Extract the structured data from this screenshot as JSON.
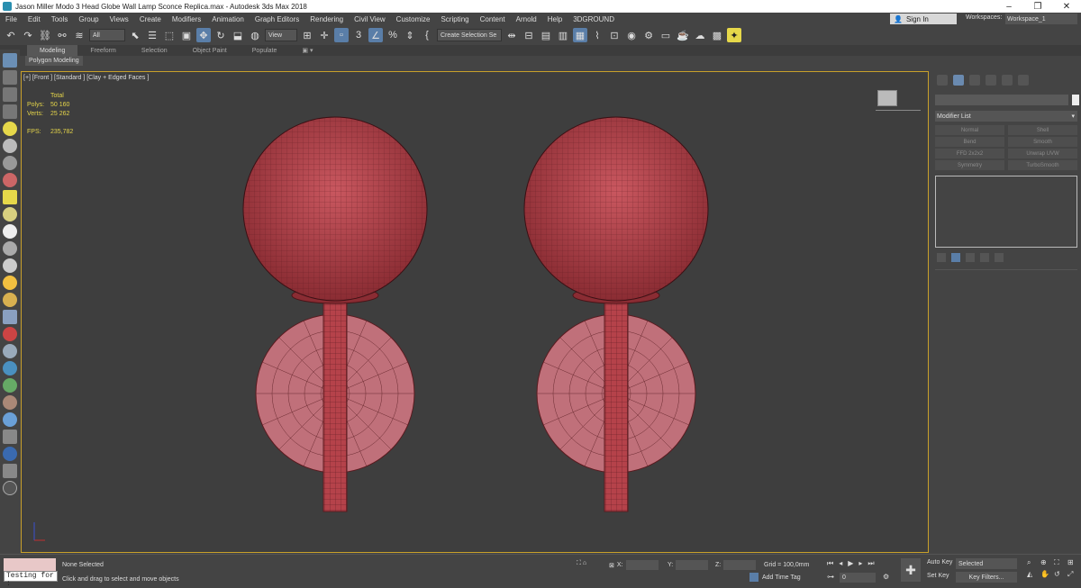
{
  "titlebar": {
    "title": "Jason Miller Modo 3 Head Globe Wall Lamp Sconce Replica.max - Autodesk 3ds Max 2018",
    "minimize": "–",
    "maximize": "❐",
    "close": "✕"
  },
  "menu": {
    "items": [
      "File",
      "Edit",
      "Tools",
      "Group",
      "Views",
      "Create",
      "Modifiers",
      "Animation",
      "Graph Editors",
      "Rendering",
      "Civil View",
      "Customize",
      "Scripting",
      "Content",
      "Arnold",
      "Help",
      "3DGROUND"
    ],
    "sign_in": "Sign In",
    "workspaces_label": "Workspaces:",
    "workspace_value": "Workspace_1"
  },
  "toolbar": {
    "filter_value": "All",
    "refcoord_value": "View",
    "snap_label": "3",
    "named_selection_placeholder": "Create Selection Se"
  },
  "ribbon": {
    "tabs": [
      "Modeling",
      "Freeform",
      "Selection",
      "Object Paint",
      "Populate"
    ],
    "sub_label": "Polygon Modeling"
  },
  "viewport": {
    "label": "[+] [Front ] [Standard ] [Clay + Edged Faces ]",
    "stats": {
      "total_label": "Total",
      "polys_label": "Polys:",
      "polys_value": "50 160",
      "verts_label": "Verts:",
      "verts_value": "25 262",
      "fps_label": "FPS:",
      "fps_value": "235,782"
    }
  },
  "command_panel": {
    "modifier_list": "Modifier List",
    "modifier_buttons": [
      "Normal",
      "Shell",
      "Bend",
      "Smooth",
      "FFD 2x2x2",
      "Unwrap UVW",
      "Symmetry",
      "TurboSmooth"
    ]
  },
  "status": {
    "maxscript_input": "Testing for :",
    "selection_text": "None Selected",
    "prompt_text": "Click and drag to select and move objects",
    "x_label": "X:",
    "y_label": "Y:",
    "z_label": "Z:",
    "grid_text": "Grid = 100,0mm",
    "add_time_tag": "Add Time Tag",
    "frame_value": "0",
    "auto_key": "Auto Key",
    "set_key": "Set Key",
    "selected_value": "Selected",
    "key_filters": "Key Filters..."
  },
  "colors": {
    "accent": "#5a7ea8",
    "viewport_border": "#c8a02a",
    "globe": "#b5424a",
    "disk": "#c0707a",
    "stats": "#e4d44a"
  }
}
